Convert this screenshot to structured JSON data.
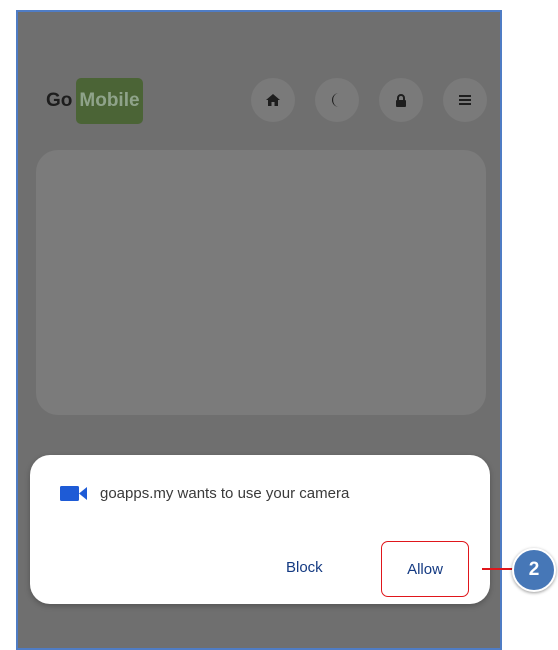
{
  "header": {
    "logo_go": "Go",
    "logo_mobile": "Mobile",
    "icons": [
      "home-icon",
      "moon-icon",
      "lock-icon",
      "menu-icon"
    ]
  },
  "permission_dialog": {
    "message": "goapps.my wants to use your camera",
    "block_label": "Block",
    "allow_label": "Allow",
    "icon": "video-camera-icon"
  },
  "callout": {
    "step": "2",
    "color": "#4677b7",
    "highlight_color": "#e0161b"
  }
}
